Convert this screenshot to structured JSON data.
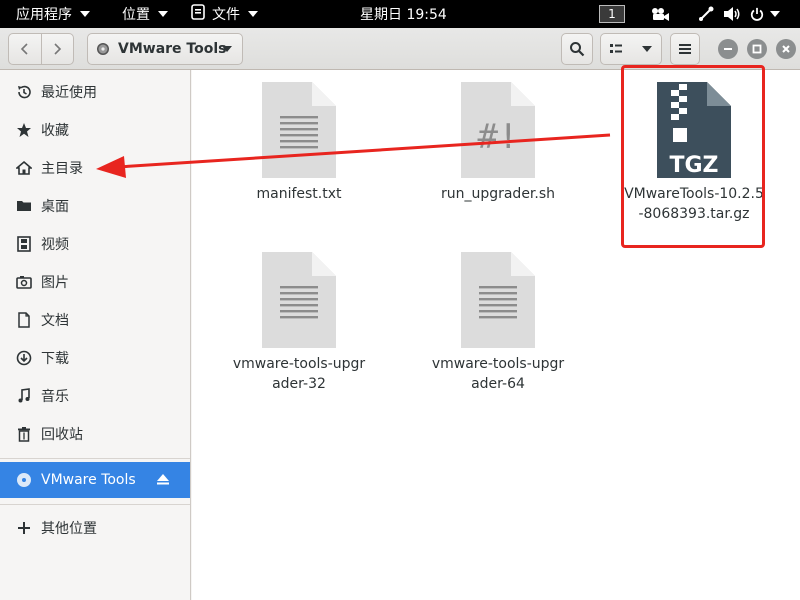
{
  "topbar": {
    "apps_menu": "应用程序",
    "places_menu": "位置",
    "files_menu": "文件",
    "clock": "星期日 19:54",
    "workspace": "1",
    "icons": [
      "video-camera-icon",
      "network-icon",
      "volume-icon",
      "power-icon"
    ]
  },
  "headerbar": {
    "path_label": "VMware Tools",
    "icons": [
      "back-icon",
      "forward-icon",
      "disc-icon",
      "search-icon",
      "view-list-icon",
      "menu-icon",
      "minimize-icon",
      "maximize-icon",
      "close-icon"
    ]
  },
  "sidebar": {
    "items": [
      {
        "label": "最近使用",
        "icon": "clock-icon"
      },
      {
        "label": "收藏",
        "icon": "star-icon"
      },
      {
        "label": "主目录",
        "icon": "home-icon"
      },
      {
        "label": "桌面",
        "icon": "folder-icon"
      },
      {
        "label": "视频",
        "icon": "film-icon"
      },
      {
        "label": "图片",
        "icon": "camera-icon"
      },
      {
        "label": "文档",
        "icon": "document-icon"
      },
      {
        "label": "下载",
        "icon": "download-icon"
      },
      {
        "label": "音乐",
        "icon": "music-icon"
      },
      {
        "label": "回收站",
        "icon": "trash-icon"
      }
    ],
    "device": {
      "label": "VMware Tools",
      "icon": "disc-icon",
      "eject_icon": "eject-icon"
    },
    "other": {
      "label": "其他位置",
      "icon": "plus-icon"
    }
  },
  "files": [
    {
      "name": "manifest.txt",
      "type": "text"
    },
    {
      "name": "run_upgrader.sh",
      "type": "script",
      "glyph": "#!"
    },
    {
      "name": "VMwareTools-10.2.5-8068393.tar.gz",
      "type": "archive",
      "badge": "TGZ"
    },
    {
      "name": "vmware-tools-upgrader-32",
      "type": "text"
    },
    {
      "name": "vmware-tools-upgrader-64",
      "type": "text"
    }
  ],
  "colors": {
    "accent": "#3584e4",
    "annotation": "#e8251f",
    "archive": "#3d4f5c"
  }
}
